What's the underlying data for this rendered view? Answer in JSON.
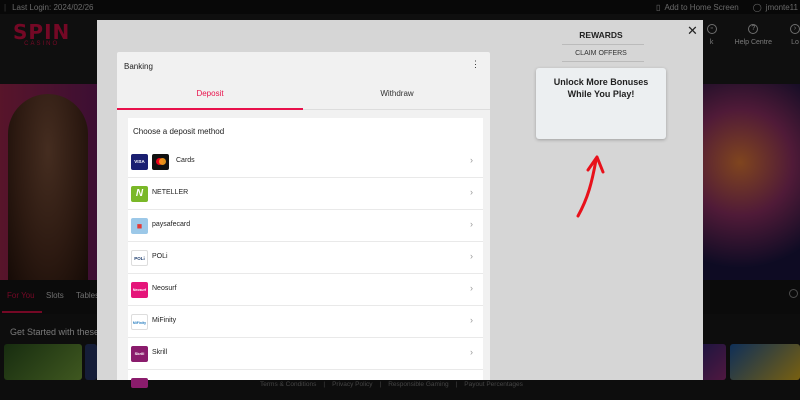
{
  "topbar": {
    "last_login": "Last Login: 2024/02/26",
    "add_home": "Add to Home Screen",
    "username": "jmonte11"
  },
  "header": {
    "logo_main": "SPIN",
    "logo_sub": "CASINO",
    "items": [
      {
        "label": "k"
      },
      {
        "label": "Help Centre"
      },
      {
        "label": "Lo"
      }
    ]
  },
  "nav": {
    "tabs": [
      "For You",
      "Slots",
      "Tables"
    ]
  },
  "section": {
    "title": "Get Started with these"
  },
  "footer": {
    "links": [
      "Terms & Conditions",
      "|",
      "Privacy Policy",
      "|",
      "Responsible Gaming",
      "|",
      "Payout Percentages"
    ]
  },
  "banking": {
    "title": "Banking",
    "tab_deposit": "Deposit",
    "tab_withdraw": "Withdraw",
    "choose_label": "Choose a deposit method",
    "methods": [
      {
        "name": "Cards",
        "logo_text": "VISA",
        "logo_bg": "#1a1f71"
      },
      {
        "name": "NETELLER",
        "logo_text": "N",
        "logo_bg": "#7ab828"
      },
      {
        "name": "paysafecard",
        "logo_text": "psc",
        "logo_bg": "#e53935"
      },
      {
        "name": "POLi",
        "logo_text": "POLi",
        "logo_bg": "#ffffff"
      },
      {
        "name": "Neosurf",
        "logo_text": "Neosurf",
        "logo_bg": "#e5157a"
      },
      {
        "name": "MiFinity",
        "logo_text": "MiFinity",
        "logo_bg": "#ffffff"
      },
      {
        "name": "Skrill",
        "logo_text": "Skrill",
        "logo_bg": "#8a1c6c"
      }
    ]
  },
  "rewards": {
    "title": "REWARDS",
    "claim": "CLAIM OFFERS",
    "card_text": "Unlock More Bonuses While You Play!"
  },
  "colors": {
    "accent": "#e8114b",
    "modal_bg": "#d6d6d6",
    "arrow": "#e8111b"
  },
  "icons": {
    "close": "close-icon",
    "kebab": "kebab-menu-icon",
    "chevron": "chevron-right-icon"
  }
}
